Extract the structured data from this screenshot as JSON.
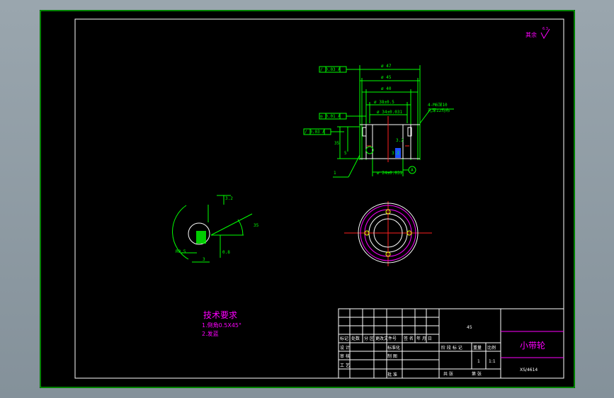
{
  "drawing": {
    "roughness_label": "其余",
    "roughness_value": "6.3",
    "part_name": "小带轮",
    "drawing_number": "XS/4614",
    "material": "45",
    "scale": "1:1",
    "quantity": "1"
  },
  "dimensions": {
    "d47": "ø 47",
    "d45": "ø 45",
    "d40": "ø 40",
    "d38": "ø 38±0.5",
    "d34": "ø 34±0.031",
    "d24": "ø 24±0.031",
    "tol1": "/ 0.03 A",
    "tol2": "◎ 0.01 A",
    "tol3": "/ 0.03 A",
    "hole_note_1": "4-M6深10",
    "hole_note_2": "孔深12均布",
    "len_h": "35",
    "len_s": "5",
    "len_t": "3.2",
    "len_b": "3.2",
    "datum_a": "A",
    "leader_1": "1",
    "detail_r": "R0.5",
    "detail_a": "3.2",
    "detail_b": "0.8",
    "detail_c": "3",
    "detail_d": "35"
  },
  "requirements": {
    "title": "技术要求",
    "item1": "1.倒角0.5X45°",
    "item2": "2.发蓝"
  },
  "title_block": {
    "h_mark": "标记",
    "h_count": "处数",
    "h_zone": "分 区",
    "h_change": "更改文件号",
    "h_sign": "签 名",
    "h_date": "年 月 日",
    "r_design": "设 计",
    "r_std": "标准化",
    "r_check": "审 核",
    "r_craft": "工 艺",
    "r_drawn": "制 图",
    "r_approve": "批 准",
    "stage": "阶 段 标 记",
    "weight": "重量",
    "ratio": "比例",
    "sheets": "共 张",
    "sheet": "第 张"
  }
}
